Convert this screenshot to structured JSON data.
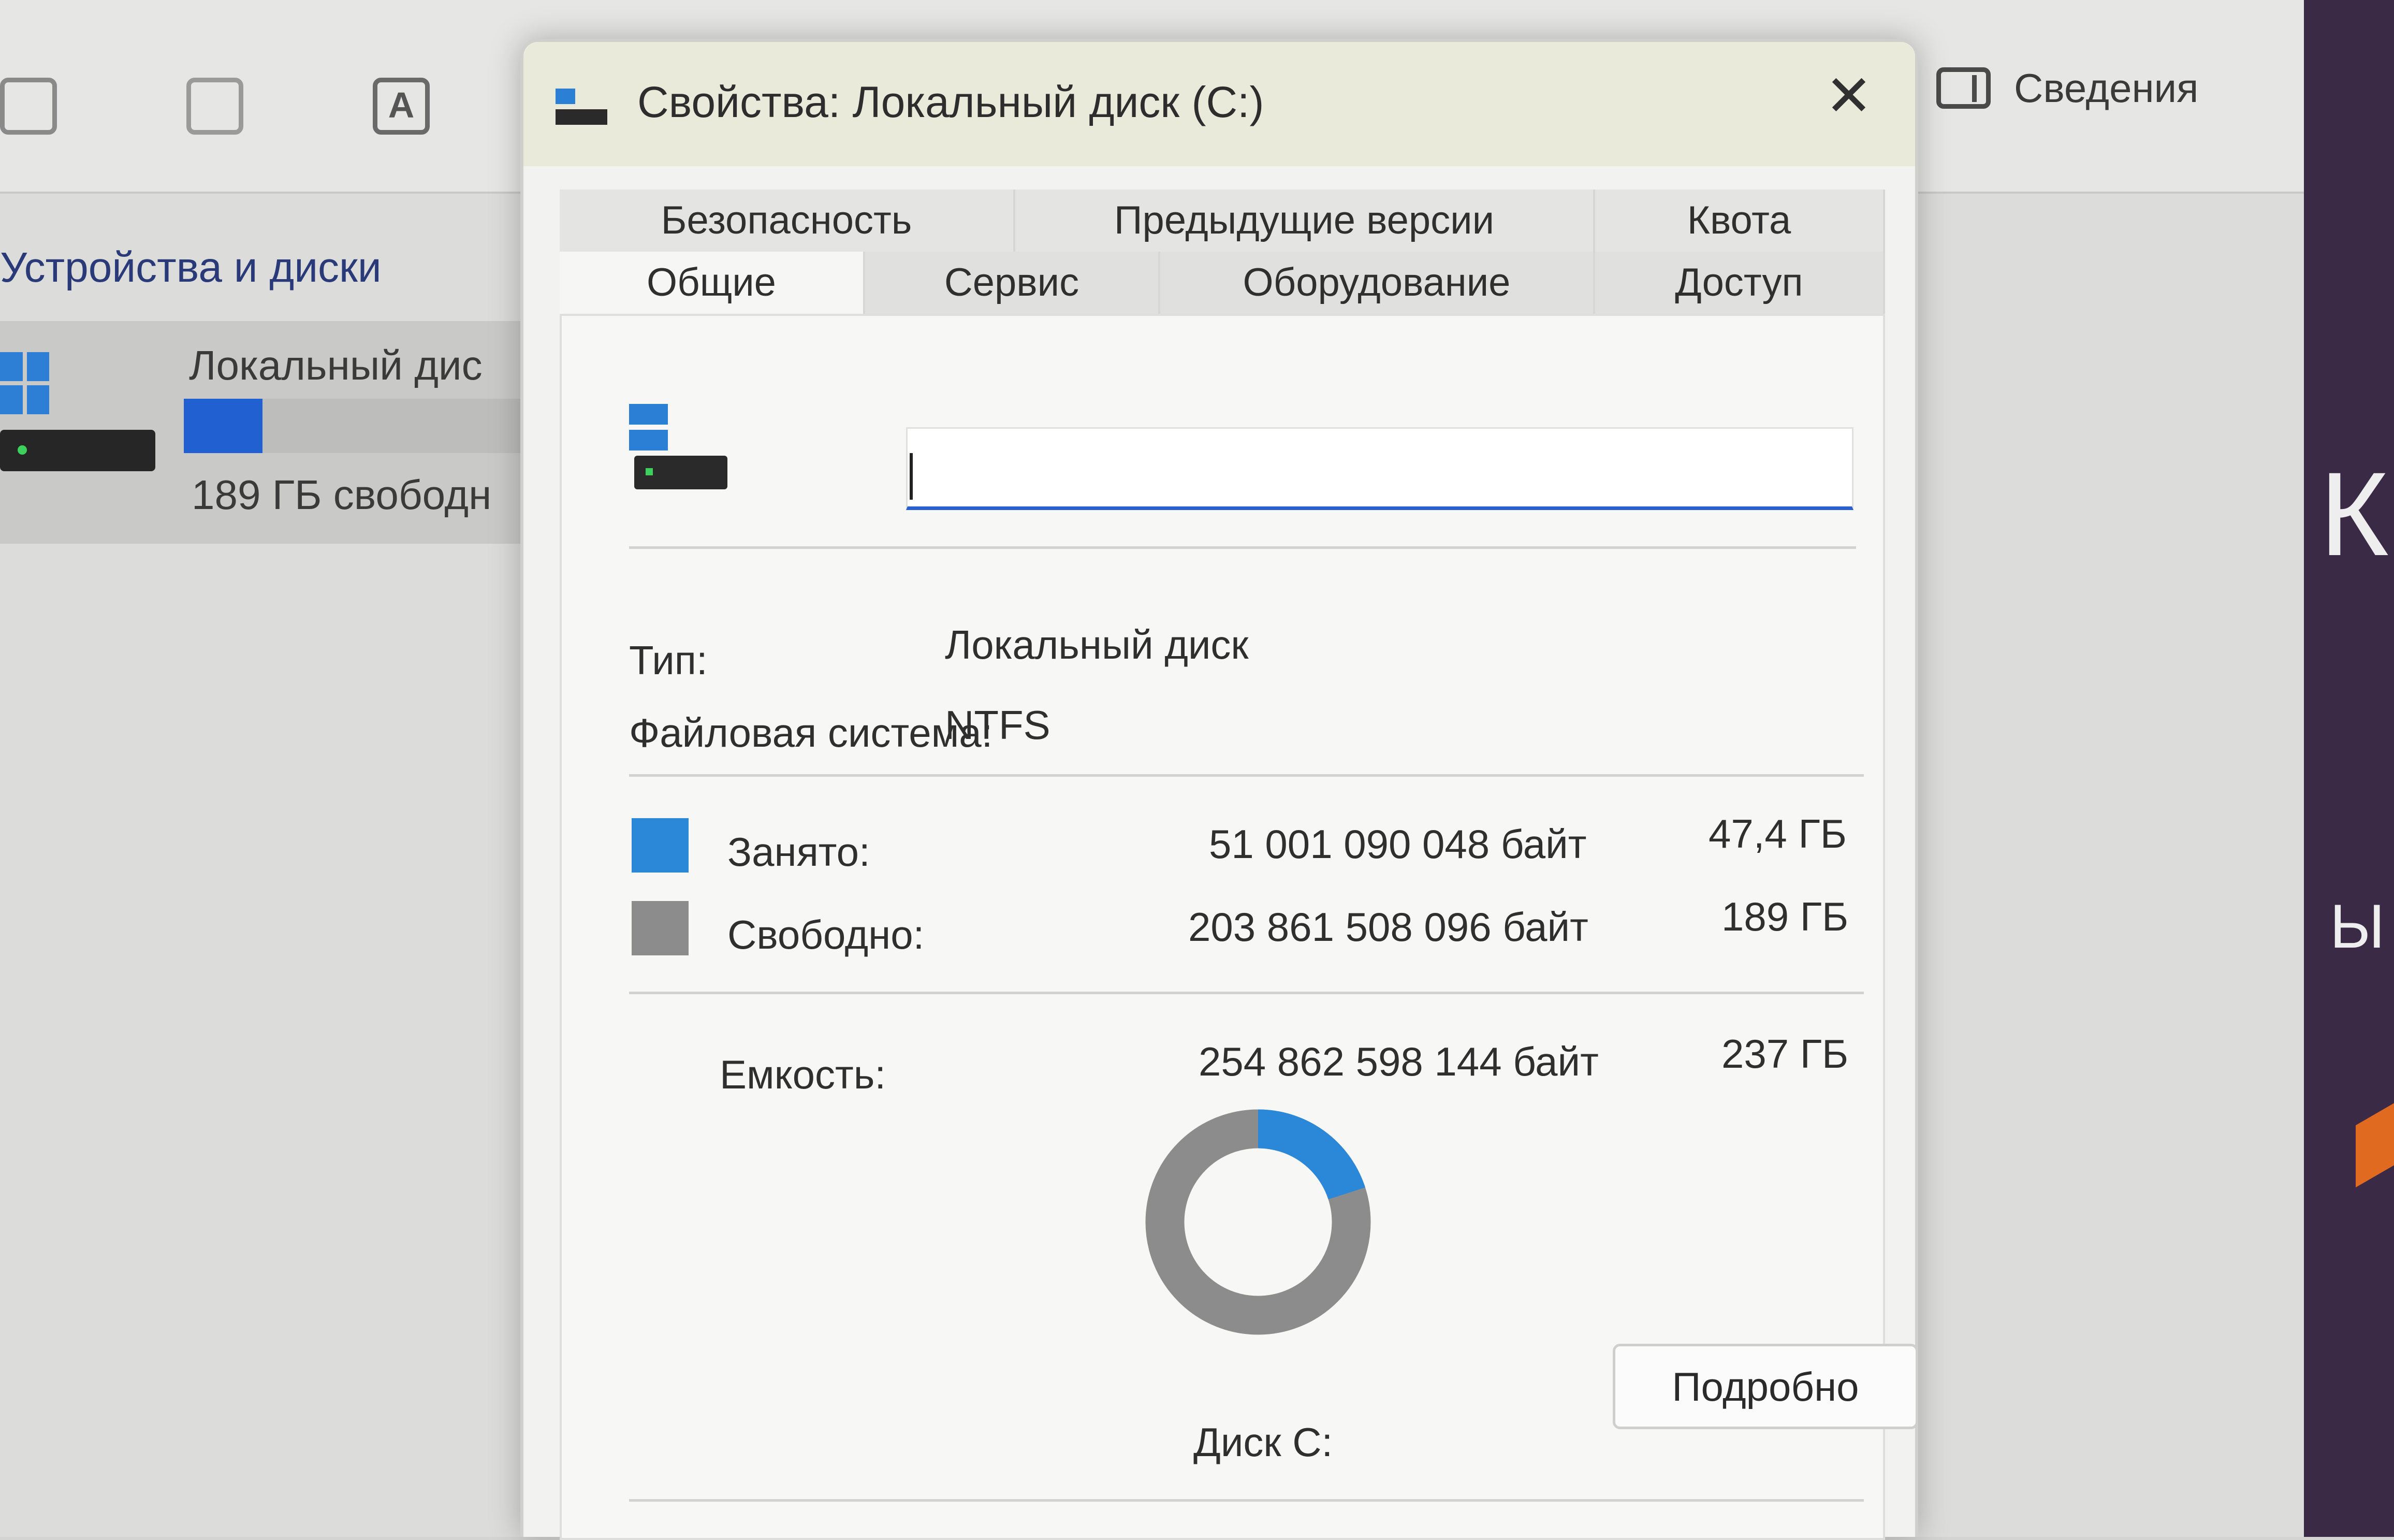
{
  "explorer": {
    "section_title": "Устройства и диски",
    "drive_name": "Локальный дис",
    "drive_free": "189 ГБ свободн",
    "drive_used_fraction": 0.2,
    "details_label": "Сведения"
  },
  "background_right": {
    "letter": "К",
    "letter2": "Ы"
  },
  "dialog": {
    "title": "Свойства: Локальный диск (C:)",
    "close_glyph": "✕",
    "tabs_back": [
      "Безопасность",
      "Предыдущие версии",
      "Квота"
    ],
    "tabs_front": [
      "Общие",
      "Сервис",
      "Оборудование",
      "Доступ"
    ],
    "active_tab": "Общие",
    "name_value": "",
    "type_label": "Тип:",
    "type_value": "Локальный диск",
    "fs_label": "Файловая система:",
    "fs_value": "NTFS",
    "used_label": "Занято:",
    "used_bytes": "51 001 090 048 байт",
    "used_size": "47,4 ГБ",
    "free_label": "Свободно:",
    "free_bytes": "203 861 508 096 байт",
    "free_size": "189 ГБ",
    "capacity_label": "Емкость:",
    "capacity_bytes": "254 862 598 144 байт",
    "capacity_size": "237 ГБ",
    "disk_label": "Диск C:",
    "details_button": "Подробно",
    "used_color": "#2b87d8",
    "free_color": "#8c8c8c",
    "used_fraction": 0.2001
  }
}
